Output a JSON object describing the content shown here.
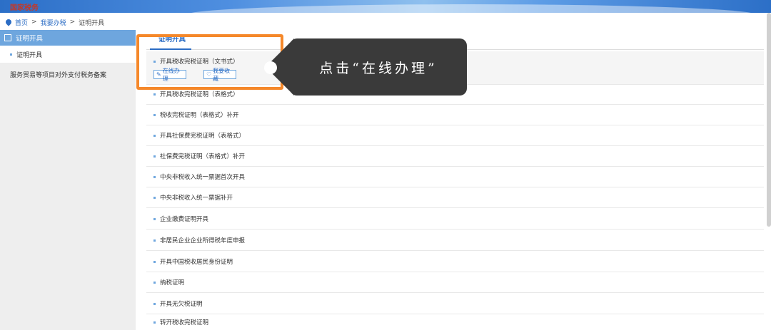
{
  "banner": {
    "logo": "国家税务"
  },
  "breadcrumb": {
    "home": "首页",
    "sep1": ">",
    "mid": "我要办税",
    "sep2": ">",
    "current": "证明开具"
  },
  "sidebar": {
    "header": "证明开具",
    "items": [
      {
        "label": "证明开具"
      },
      {
        "label": "服务贸易等项目对外支付税务备案"
      }
    ]
  },
  "main": {
    "tab": "证明开具",
    "first_item": {
      "label": "开具税收完税证明（文书式）",
      "online_btn": "在线办理",
      "fav_btn": "我要收藏"
    },
    "items": [
      "开具税收完税证明（表格式）",
      "税收完税证明（表格式）补开",
      "开具社保费完税证明（表格式）",
      "社保费完税证明（表格式）补开",
      "中央非税收入统一票据首次开具",
      "中央非税收入统一票据补开",
      "企业缴费证明开具",
      "非居民企业企业所得税年度申报",
      "开具中国税收居民身份证明",
      "纳税证明",
      "开具无欠税证明",
      "转开税收完税证明"
    ]
  },
  "callout": {
    "text": "点击“在线办理”"
  },
  "colors": {
    "accent": "#2b6cc4",
    "highlight": "#f5882a",
    "callout_bg": "#3a3a3a"
  }
}
